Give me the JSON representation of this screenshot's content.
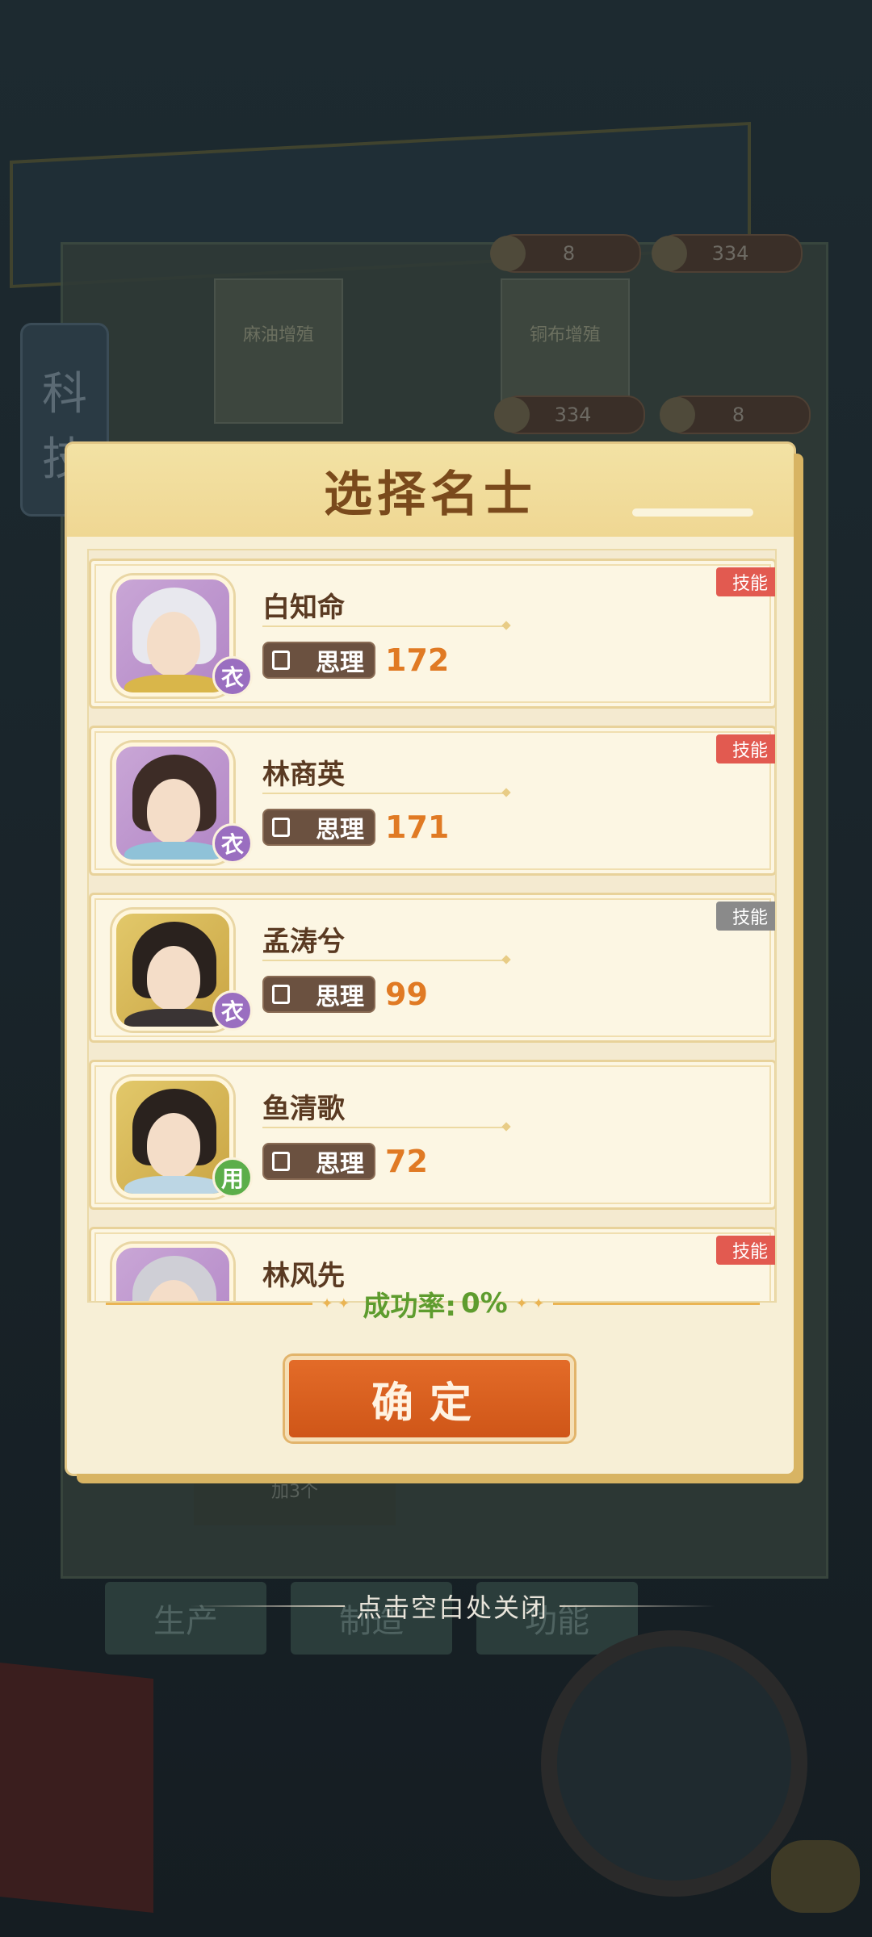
{
  "background": {
    "left_tab_text": "科技",
    "books": [
      "麻油增殖",
      "铜布增殖"
    ],
    "pills_top": [
      "8",
      "334"
    ],
    "pills_mid": [
      "334",
      "8"
    ],
    "sub_text": "加3个",
    "bottom_tabs": [
      "生产",
      "制造",
      "功能"
    ]
  },
  "dialog": {
    "title": "选择名士",
    "skill_label": "技能",
    "stat_label": "思理",
    "characters": [
      {
        "name": "白知命",
        "stat": "172",
        "tag": "衣",
        "tag_color": "#9a6ec0",
        "avatar_bg": "purple",
        "skill_active": true
      },
      {
        "name": "林商英",
        "stat": "171",
        "tag": "衣",
        "tag_color": "#9a6ec0",
        "avatar_bg": "purple",
        "skill_active": true
      },
      {
        "name": "孟涛兮",
        "stat": "99",
        "tag": "衣",
        "tag_color": "#9a6ec0",
        "avatar_bg": "gold",
        "skill_active": false
      },
      {
        "name": "鱼清歌",
        "stat": "72",
        "tag": "用",
        "tag_color": "#5cae4a",
        "avatar_bg": "gold",
        "skill_active": null
      },
      {
        "name": "林风先",
        "stat": "",
        "tag": "",
        "tag_color": "",
        "avatar_bg": "purple",
        "skill_active": true
      }
    ],
    "success_rate_label": "成功率:",
    "success_rate_value": "0%",
    "confirm_label": "确定"
  },
  "close_hint": "点击空白处关闭",
  "colors": {
    "accent_orange": "#e07a24",
    "title_brown": "#7a4a1c",
    "skill_red": "#e25a50",
    "skill_grey": "#8a8a8a",
    "rate_green": "#5e9c2e"
  }
}
